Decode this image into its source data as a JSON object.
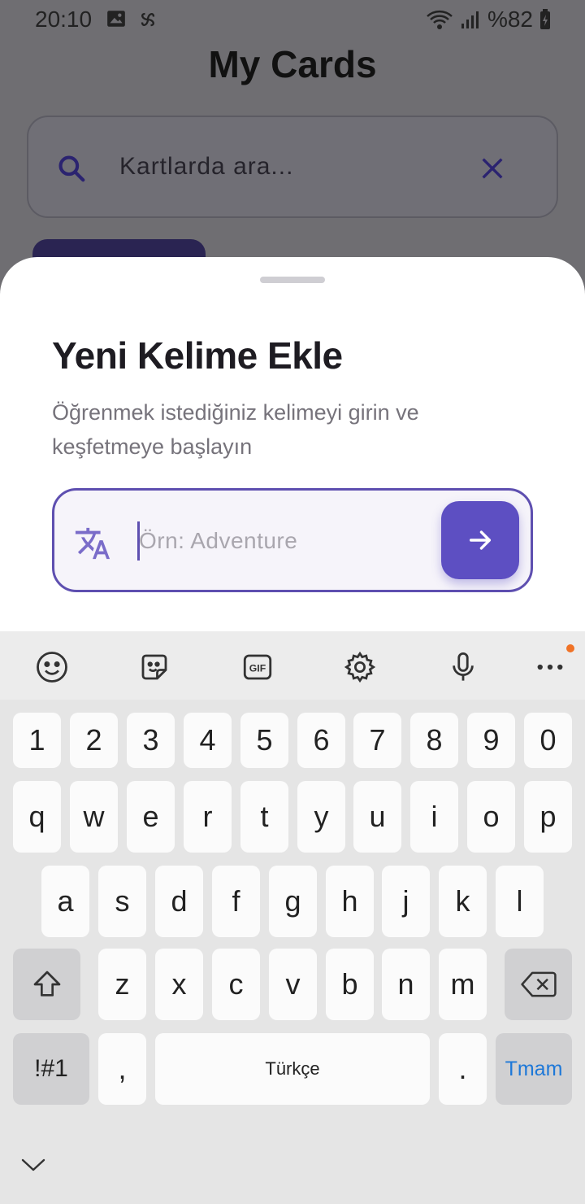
{
  "status": {
    "time": "20:10",
    "battery": "%82",
    "icons_left": [
      "image-icon",
      "pinwheel-icon"
    ],
    "icons_right": [
      "wifi-icon",
      "signal-icon",
      "battery-charging-icon"
    ]
  },
  "header": {
    "title": "My Cards"
  },
  "search": {
    "placeholder": "Kartlarda ara..."
  },
  "sheet": {
    "title": "Yeni Kelime Ekle",
    "subtitle": "Öğrenmek istediğiniz kelimeyi girin ve keşfetmeye başlayın",
    "input_placeholder": "Örn: Adventure",
    "input_value": ""
  },
  "colors": {
    "accent": "#5D4FC2",
    "done_blue": "#1E78D8",
    "notification": "#F07226"
  },
  "keyboard": {
    "toolbar": [
      "emoji-icon",
      "sticker-icon",
      "gif-icon",
      "settings-icon",
      "microphone-icon",
      "more-icon"
    ],
    "toolbar_gif_label": "GIF",
    "row_numbers": [
      "1",
      "2",
      "3",
      "4",
      "5",
      "6",
      "7",
      "8",
      "9",
      "0"
    ],
    "row1": [
      "q",
      "w",
      "e",
      "r",
      "t",
      "y",
      "u",
      "i",
      "o",
      "p"
    ],
    "row2": [
      "a",
      "s",
      "d",
      "f",
      "g",
      "h",
      "j",
      "k",
      "l"
    ],
    "row3": [
      "z",
      "x",
      "c",
      "v",
      "b",
      "n",
      "m"
    ],
    "symbols_label": "!#1",
    "comma": ",",
    "space_label": "Türkçe",
    "period": ".",
    "done_label": "Tmam"
  }
}
